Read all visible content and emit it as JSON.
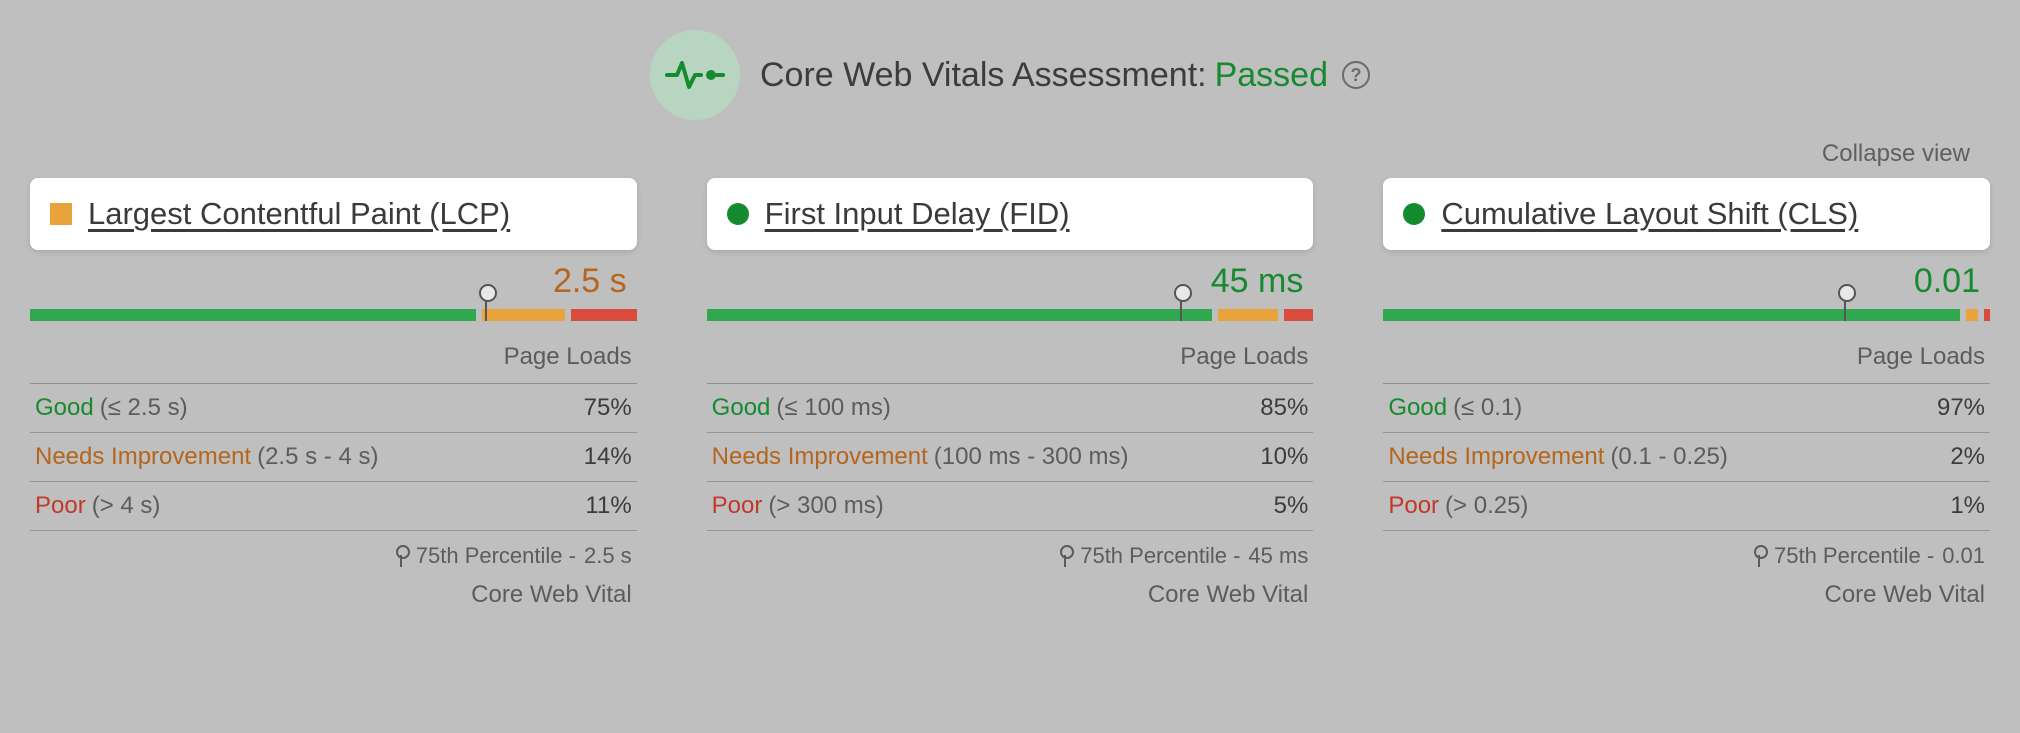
{
  "header": {
    "title_prefix": "Core Web Vitals Assessment:",
    "status": "Passed",
    "help_glyph": "?"
  },
  "collapse_label": "Collapse view",
  "labels": {
    "page_loads": "Page Loads",
    "good": "Good",
    "needs_improvement": "Needs Improvement",
    "poor": "Poor",
    "percentile_prefix": "75th Percentile -",
    "cwv": "Core Web Vital"
  },
  "metrics": [
    {
      "id": "lcp",
      "title": "Largest Contentful Paint (LCP)",
      "status_shape": "square",
      "status_color": "#e8a33d",
      "value": "2.5 s",
      "value_class": "value-orange",
      "dist": {
        "good": 75,
        "ni": 14,
        "poor": 11
      },
      "ranges": {
        "good": "(≤ 2.5 s)",
        "ni": "(2.5 s - 4 s)",
        "poor": "(> 4 s)"
      },
      "percentile_value": "2.5 s"
    },
    {
      "id": "fid",
      "title": "First Input Delay (FID)",
      "status_shape": "circle",
      "status_color": "#168a2f",
      "value": "45 ms",
      "value_class": "value-green",
      "dist": {
        "good": 85,
        "ni": 10,
        "poor": 5
      },
      "ranges": {
        "good": "(≤ 100 ms)",
        "ni": "(100 ms - 300 ms)",
        "poor": "(> 300 ms)"
      },
      "percentile_value": "45 ms"
    },
    {
      "id": "cls",
      "title": "Cumulative Layout Shift (CLS)",
      "status_shape": "circle",
      "status_color": "#168a2f",
      "value": "0.01",
      "value_class": "value-green",
      "dist": {
        "good": 97,
        "ni": 2,
        "poor": 1
      },
      "ranges": {
        "good": "(≤ 0.1)",
        "ni": "(0.1 - 0.25)",
        "poor": "(> 0.25)"
      },
      "percentile_value": "0.01"
    }
  ],
  "chart_data": [
    {
      "type": "bar",
      "title": "Largest Contentful Paint (LCP) – Page Loads distribution",
      "categories": [
        "Good",
        "Needs Improvement",
        "Poor"
      ],
      "values": [
        75,
        14,
        11
      ],
      "ylabel": "Page Loads (%)",
      "ylim": [
        0,
        100
      ],
      "marker_percentile": 75,
      "marker_value": "2.5 s"
    },
    {
      "type": "bar",
      "title": "First Input Delay (FID) – Page Loads distribution",
      "categories": [
        "Good",
        "Needs Improvement",
        "Poor"
      ],
      "values": [
        85,
        10,
        5
      ],
      "ylabel": "Page Loads (%)",
      "ylim": [
        0,
        100
      ],
      "marker_percentile": 75,
      "marker_value": "45 ms"
    },
    {
      "type": "bar",
      "title": "Cumulative Layout Shift (CLS) – Page Loads distribution",
      "categories": [
        "Good",
        "Needs Improvement",
        "Poor"
      ],
      "values": [
        97,
        2,
        1
      ],
      "ylabel": "Page Loads (%)",
      "ylim": [
        0,
        100
      ],
      "marker_percentile": 75,
      "marker_value": "0.01"
    }
  ]
}
